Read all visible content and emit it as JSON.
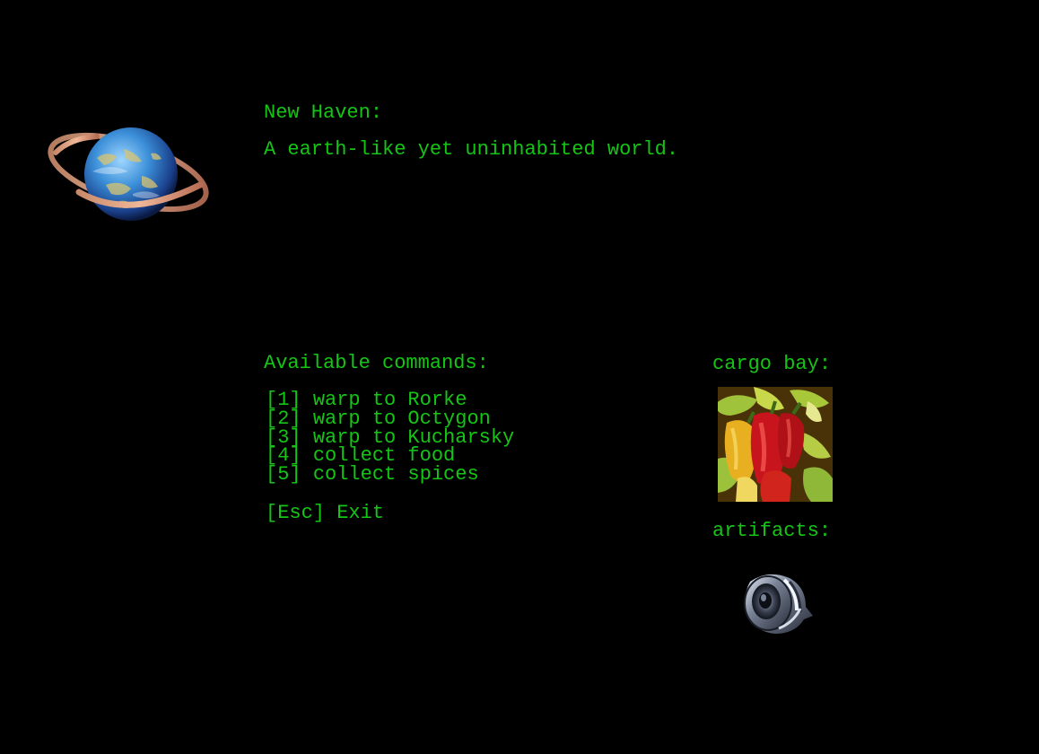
{
  "planet": {
    "name": "New Haven:",
    "description": "A earth-like yet uninhabited world.",
    "icon": "ringed-planet-icon"
  },
  "commands": {
    "heading": "Available commands:",
    "items": [
      {
        "key": "[1]",
        "label": "warp to Rorke"
      },
      {
        "key": "[2]",
        "label": "warp to Octygon"
      },
      {
        "key": "[3]",
        "label": "warp to Kucharsky"
      },
      {
        "key": "[4]",
        "label": "collect food"
      },
      {
        "key": "[5]",
        "label": "collect spices"
      }
    ],
    "exit": {
      "key": "[Esc]",
      "label": "Exit"
    }
  },
  "cargo": {
    "heading": "cargo bay:",
    "item_icon": "chili-peppers-icon"
  },
  "artifacts": {
    "heading": "artifacts:",
    "item_icon": "metal-gadget-icon"
  },
  "colors": {
    "background": "#000000",
    "text": "#15c515"
  }
}
